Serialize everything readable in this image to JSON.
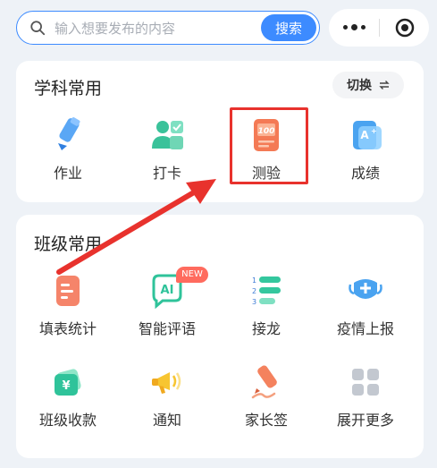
{
  "search": {
    "placeholder": "输入想要发布的内容",
    "button_label": "搜索"
  },
  "subject_section": {
    "title": "学科常用",
    "switch_label": "切换",
    "items": [
      {
        "label": "作业",
        "icon": "pencil-icon"
      },
      {
        "label": "打卡",
        "icon": "checkin-user-icon"
      },
      {
        "label": "测验",
        "icon": "quiz-score-icon"
      },
      {
        "label": "成绩",
        "icon": "grade-report-icon"
      }
    ]
  },
  "class_section": {
    "title": "班级常用",
    "badge": "NEW",
    "items": [
      {
        "label": "填表统计",
        "icon": "form-icon"
      },
      {
        "label": "智能评语",
        "icon": "ai-chat-icon"
      },
      {
        "label": "接龙",
        "icon": "numbered-list-icon"
      },
      {
        "label": "疫情上报",
        "icon": "mask-report-icon"
      },
      {
        "label": "班级收款",
        "icon": "payment-icon"
      },
      {
        "label": "通知",
        "icon": "megaphone-icon"
      },
      {
        "label": "家长签",
        "icon": "signature-pen-icon"
      },
      {
        "label": "展开更多",
        "icon": "grid-more-icon"
      }
    ]
  },
  "colors": {
    "accent": "#3d8bff",
    "highlight": "#e8322d"
  }
}
